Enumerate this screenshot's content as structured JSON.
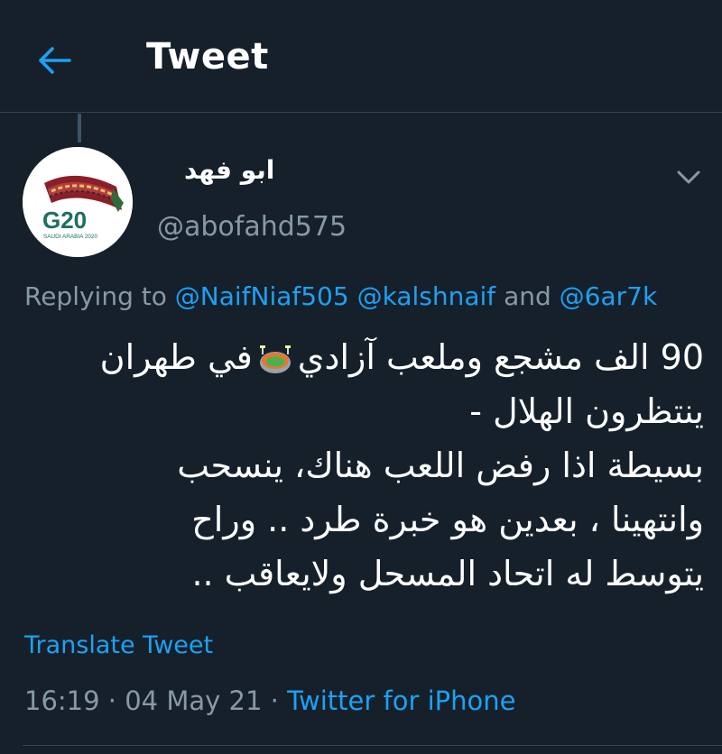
{
  "header": {
    "back_icon": "arrow-left-icon",
    "title": "Tweet"
  },
  "tweet": {
    "avatar_icon": "g20-saudi-arabia-logo",
    "avatar_logo_text": "G20",
    "avatar_logo_subtext": "SAUDI ARABIA 2020",
    "display_name": "ابو فهد",
    "handle": "@abofahd575",
    "more_icon": "chevron-down-icon",
    "replying_prefix": "Replying to",
    "mentions": [
      "@NaifNiaf505",
      "@kalshnaif"
    ],
    "replying_and": "and",
    "mention_last": "@6ar7k",
    "text_line1_a": "90 الف مشجع وملعب آزادي",
    "text_line1_b": "في طهران",
    "stadium_emoji": "stadium-icon",
    "text_line2": "ينتظرون الهلال -",
    "text_line3": "بسيطة اذا رفض اللعب هناك، ينسحب",
    "text_line4": "وانتهينا ، بعدين هو خبرة طرد .. وراح",
    "text_line5": "يتوسط له اتحاد المسحل ولايعاقب ..",
    "translate_label": "Translate Tweet",
    "time": "16:19",
    "date": "04 May 21",
    "separator": "·",
    "source": "Twitter for iPhone"
  },
  "colors": {
    "background": "#15202b",
    "accent": "#1da1f2",
    "secondary_text": "#8899a6",
    "divider": "#38444d"
  }
}
